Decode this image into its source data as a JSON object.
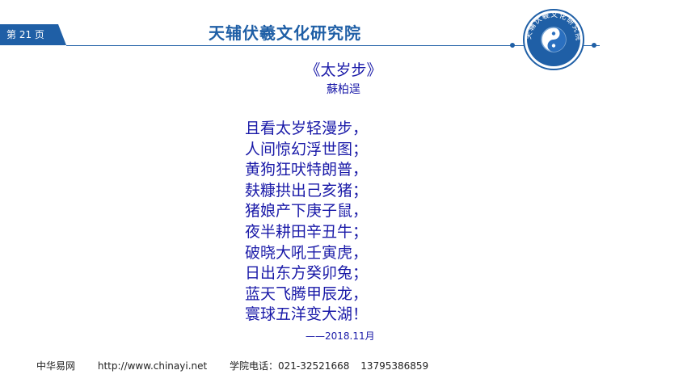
{
  "header": {
    "page_label": "第 21 页",
    "title": "天辅伏羲文化研究院",
    "logo_text": "天辅伏羲文化研究院"
  },
  "poem": {
    "title": "《太岁步》",
    "author": "蘇柏逞",
    "lines": [
      "且看太岁轻漫步，",
      "人间惊幻浮世图；",
      "黄狗狂吠特朗普，",
      "麸糠拱出己亥猪；",
      "猪娘产下庚子鼠，",
      "夜半耕田辛丑牛；",
      "破晓大吼壬寅虎，",
      "日出东方癸卯兔；",
      "蓝天飞腾甲辰龙，",
      "寰球五洋变大湖！"
    ],
    "date": "——2018.11月"
  },
  "footer": {
    "site_name": "中华易网",
    "url": "http://www.chinayi.net",
    "phone_label": "学院电话：021-32521668",
    "phone_2": "13795386859"
  },
  "colors": {
    "brand_blue": "#1f5fa6",
    "poem_blue": "#1a1aa8"
  }
}
